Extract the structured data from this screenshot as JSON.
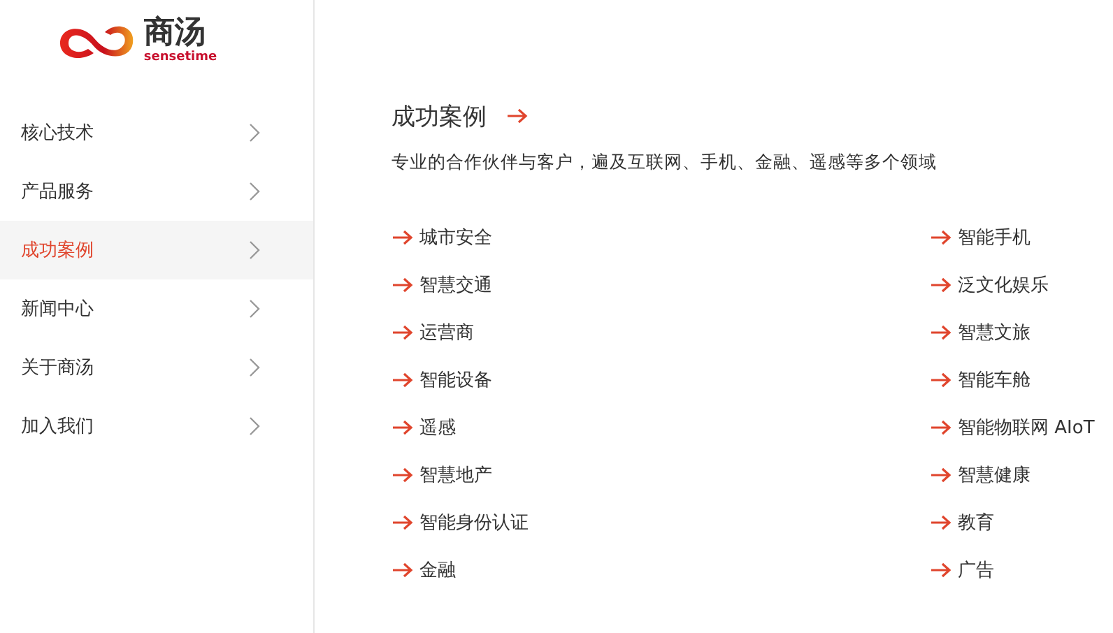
{
  "logo": {
    "name": "商汤",
    "subtitle": "sensetime"
  },
  "sidebar": {
    "items": [
      {
        "label": "核心技术",
        "selected": false
      },
      {
        "label": "产品服务",
        "selected": false
      },
      {
        "label": "成功案例",
        "selected": true
      },
      {
        "label": "新闻中心",
        "selected": false
      },
      {
        "label": "关于商汤",
        "selected": false
      },
      {
        "label": "加入我们",
        "selected": false
      }
    ]
  },
  "main": {
    "title": "成功案例",
    "description": "专业的合作伙伴与客户，遍及互联网、手机、金融、遥感等多个领域",
    "links": [
      [
        "城市安全",
        "智能手机"
      ],
      [
        "智慧交通",
        "泛文化娱乐"
      ],
      [
        "运营商",
        "智慧文旅"
      ],
      [
        "智能设备",
        "智能车舱"
      ],
      [
        "遥感",
        "智能物联网 AIoT"
      ],
      [
        "智慧地产",
        "智慧健康"
      ],
      [
        "智能身份认证",
        "教育"
      ],
      [
        "金融",
        "广告"
      ]
    ]
  }
}
